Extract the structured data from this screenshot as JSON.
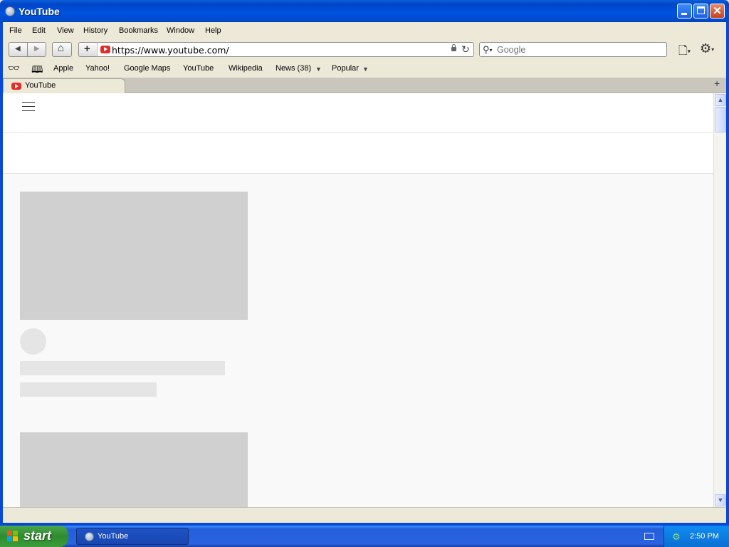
{
  "window": {
    "title": "YouTube",
    "minimize_label": "",
    "close_glyph": "✕"
  },
  "menubar": {
    "items": [
      {
        "label": "File"
      },
      {
        "label": "Edit"
      },
      {
        "label": "View"
      },
      {
        "label": "History"
      },
      {
        "label": "Bookmarks"
      },
      {
        "label": "Window"
      },
      {
        "label": "Help"
      }
    ]
  },
  "toolbar": {
    "back_glyph": "◀",
    "forward_glyph": "▶",
    "home_glyph": "⌂",
    "add_glyph": "+",
    "url": "https://www.youtube.com/",
    "reload_glyph": "↻",
    "search_placeholder": "Google",
    "search_glyph": "🔍",
    "page_menu_glyph": "🗋",
    "settings_glyph": "⚙",
    "caret": "▾",
    "icons": [
      "back-icon",
      "forward-icon",
      "home-icon",
      "add-bookmark-icon",
      "youtube-favicon-icon",
      "lock-icon",
      "reload-icon",
      "search-icon",
      "page-menu-icon",
      "settings-icon"
    ]
  },
  "bookmarks": {
    "reading_list_glyph": "👓",
    "bookmarks_glyph": "📖",
    "items": [
      {
        "label": "Apple"
      },
      {
        "label": "Yahoo!"
      },
      {
        "label": "Google Maps"
      },
      {
        "label": "YouTube"
      },
      {
        "label": "Wikipedia"
      },
      {
        "label": "News (38)"
      },
      {
        "label": "Popular"
      }
    ],
    "caret": "▼"
  },
  "tabs": {
    "items": [
      {
        "label": "YouTube"
      }
    ],
    "new_tab_glyph": "+"
  },
  "taskbar": {
    "start_label": "start",
    "tasks": [
      {
        "label": "YouTube"
      }
    ],
    "clock": "2:50 PM"
  },
  "colors": {
    "titlebar_blue": "#0052e0",
    "youtube_red": "#e52d27",
    "skeleton_gray": "#d0d0d0",
    "start_green": "#3c9c3c"
  }
}
